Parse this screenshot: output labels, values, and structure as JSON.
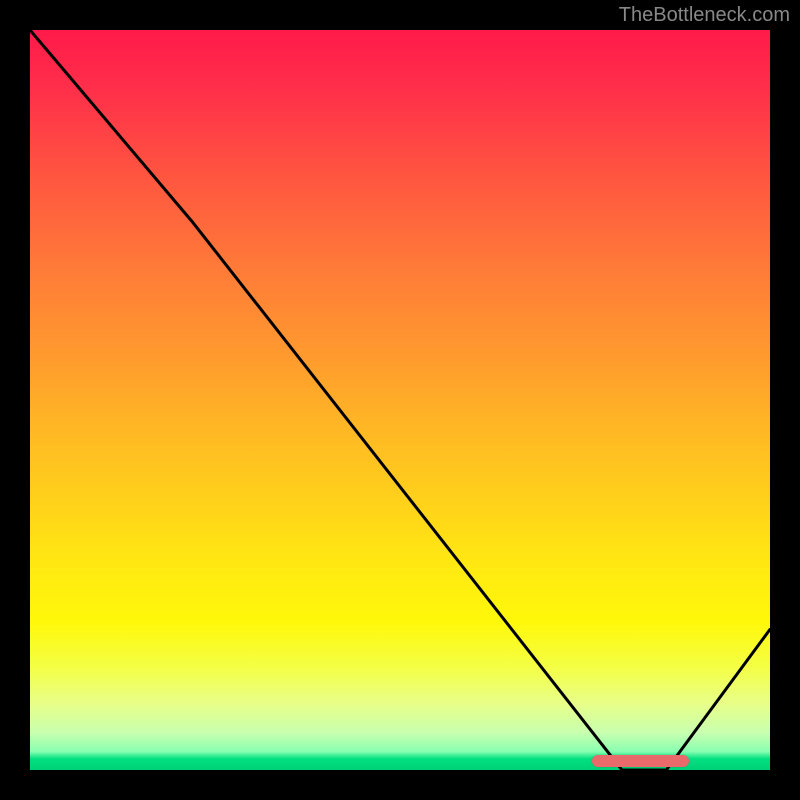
{
  "watermark": "TheBottleneck.com",
  "chart_data": {
    "type": "line",
    "title": "",
    "xlabel": "",
    "ylabel": "",
    "xlim": [
      0,
      100
    ],
    "ylim": [
      0,
      100
    ],
    "background": "vertical-gradient-red-to-green",
    "series": [
      {
        "name": "bottleneck-curve",
        "x": [
          0,
          22,
          80,
          86,
          100
        ],
        "values": [
          100,
          74,
          0,
          0,
          19
        ]
      }
    ],
    "marker": {
      "name": "optimal-range",
      "y": 1.2,
      "x_start": 76,
      "x_end": 89,
      "color": "#e86a6a"
    }
  }
}
